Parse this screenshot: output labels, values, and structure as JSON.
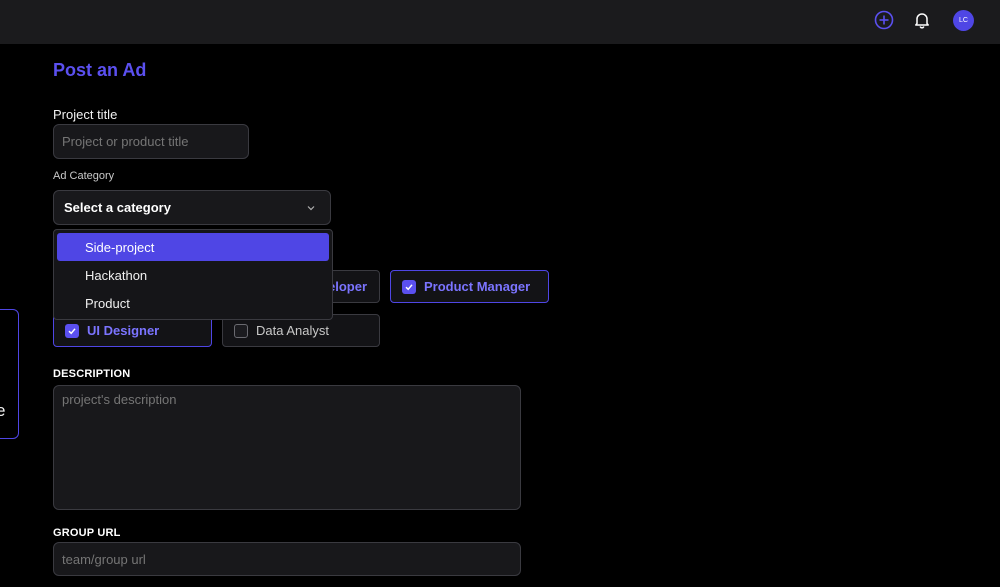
{
  "header": {
    "avatar_initials": "LC"
  },
  "form": {
    "title": "Post an Ad",
    "project_title": {
      "label": "Project title",
      "placeholder": "Project or product title",
      "value": ""
    },
    "ad_category": {
      "label": "Ad Category",
      "selected": "Select a category",
      "options": [
        "Side-project",
        "Hackathon",
        "Product"
      ],
      "highlighted_index": 0
    },
    "roles": [
      {
        "label": "eloper",
        "checked": false
      },
      {
        "label": "Product Manager",
        "checked": true
      },
      {
        "label": "UI Designer",
        "checked": true
      },
      {
        "label": "Data Analyst",
        "checked": false
      }
    ],
    "description": {
      "label": "DESCRIPTION",
      "placeholder": "project's description"
    },
    "group_url": {
      "label": "GROUP URL",
      "placeholder": "team/group url"
    }
  },
  "side_card": {
    "text": "e"
  },
  "colors": {
    "accent": "#4f46e5",
    "accent_text": "#5b50f0",
    "background": "#000000",
    "topbar": "#1b1b1d"
  }
}
